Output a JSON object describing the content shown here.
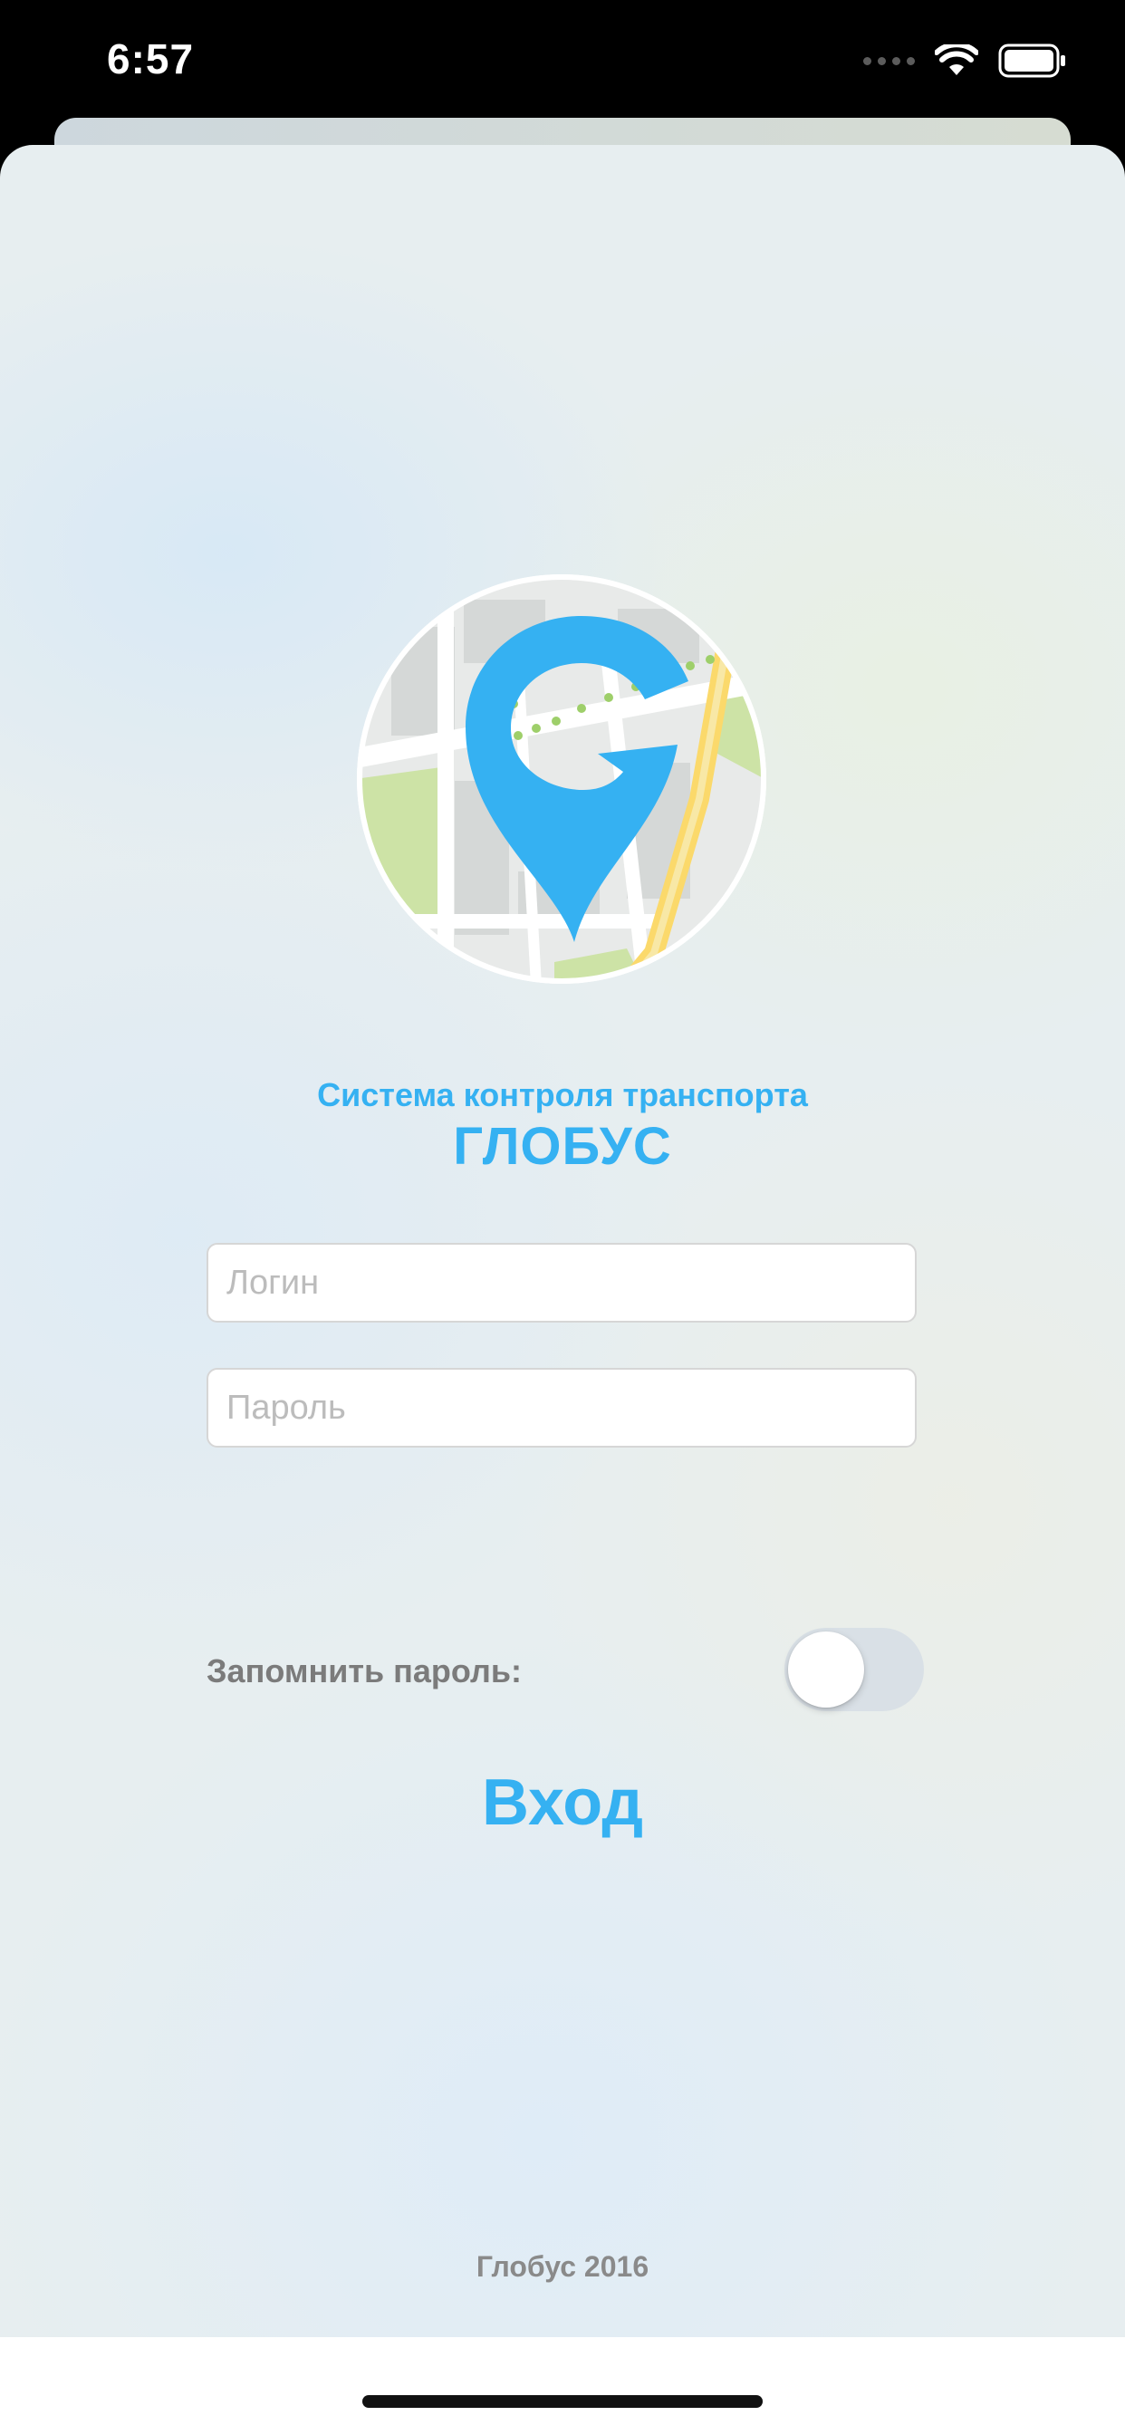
{
  "status_bar": {
    "time": "6:57",
    "icons": [
      "cellular-signal-icon",
      "wifi-icon",
      "battery-icon"
    ]
  },
  "app": {
    "subtitle": "Система контроля транспорта",
    "title": "ГЛОБУС",
    "logo": "map-pin-g-logo"
  },
  "form": {
    "login_placeholder": "Логин",
    "password_placeholder": "Пароль",
    "remember_label": "Запомнить пароль:",
    "remember_enabled": false,
    "submit_label": "Вход"
  },
  "footer": {
    "text": "Глобус 2016"
  },
  "colors": {
    "accent": "#35b1f2",
    "toggle_off": "#d9e0e6",
    "label_gray": "#7b7b7b"
  }
}
